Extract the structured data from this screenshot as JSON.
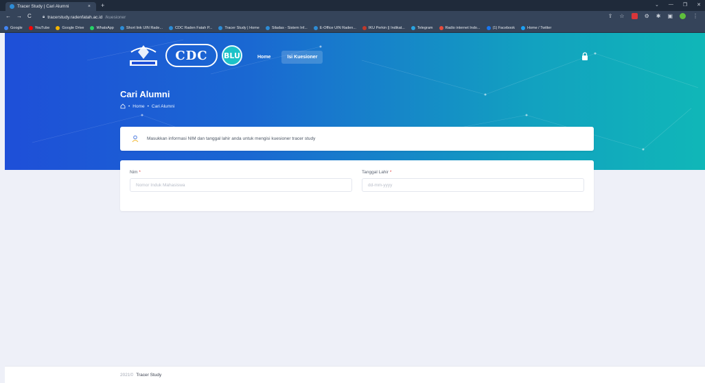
{
  "browser": {
    "tab_title": "Tracer Study | Cari Alumni",
    "tab_close": "×",
    "new_tab": "+",
    "url_host": "tracerstudy.radenfatah.ac.id",
    "url_path": "/kuesioner",
    "bookmarks": [
      {
        "label": "Google",
        "color": "#4285f4"
      },
      {
        "label": "YouTube",
        "color": "#ff0000"
      },
      {
        "label": "Google Drive",
        "color": "#f4b400"
      },
      {
        "label": "WhatsApp",
        "color": "#25d366"
      },
      {
        "label": "Short link UIN Rade...",
        "color": "#2d8cd6"
      },
      {
        "label": "CDC Raden Fatah P...",
        "color": "#2d8cd6"
      },
      {
        "label": "Tracer Study | Home",
        "color": "#2d8cd6"
      },
      {
        "label": "Siladas - Sistem Inf...",
        "color": "#2d8cd6"
      },
      {
        "label": "E-Office UIN Raden...",
        "color": "#2d8cd6"
      },
      {
        "label": "IKU Perkin || Indikat...",
        "color": "#c0392b"
      },
      {
        "label": "Telegram",
        "color": "#2aa3df"
      },
      {
        "label": "Radio internet Indo...",
        "color": "#e74c3c"
      },
      {
        "label": "(1) Facebook",
        "color": "#1877f2"
      },
      {
        "label": "Home / Twitter",
        "color": "#1da1f2"
      }
    ]
  },
  "nav": {
    "home": "Home",
    "kuesioner": "Isi Kuesioner"
  },
  "logos": {
    "cdc": "CDC",
    "blu": "BLU"
  },
  "page": {
    "title": "Cari Alumni",
    "breadcrumb_home": "Home",
    "breadcrumb_current": "Cari Alumni",
    "info_text": "Masukkan informasi NIM dan tanggal lahir anda untuk mengisi kuesioner tracer study"
  },
  "form": {
    "nim_label": "Nim",
    "nim_placeholder": "Nomor Induk Mahasiswa",
    "tgl_label": "Tanggal Lahir",
    "tgl_placeholder": "dd-mm-yyyy",
    "required_mark": "*"
  },
  "footer": {
    "year": "2021©",
    "name": "Tracer Study"
  },
  "colors": {
    "hero_start": "#1e4fd8",
    "hero_end": "#10b7b8",
    "page_bg": "#eef0f8",
    "required": "#e53e3e"
  }
}
